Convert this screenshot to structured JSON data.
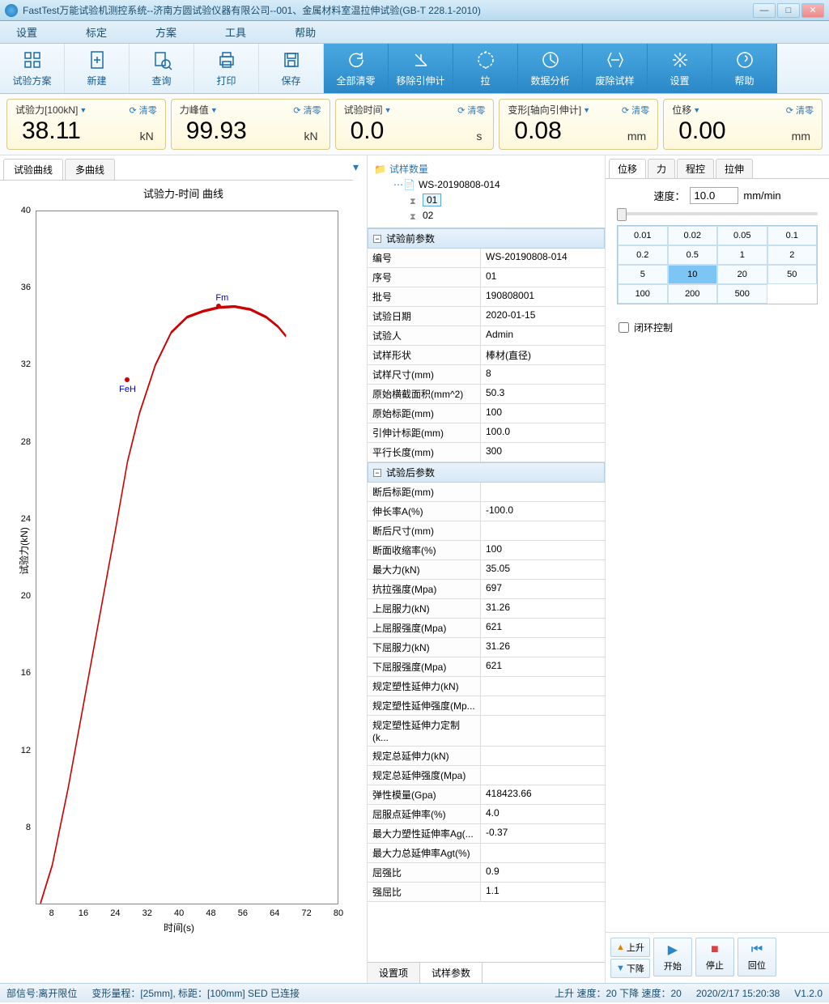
{
  "titlebar": {
    "title": "FastTest万能试验机测控系统--济南方圆试验仪器有限公司--001、金属材料室温拉伸试验(GB-T 228.1-2010)"
  },
  "menu": [
    "设置",
    "标定",
    "方案",
    "工具",
    "帮助"
  ],
  "toolbar": [
    {
      "label": "试验方案",
      "accent": false
    },
    {
      "label": "新建",
      "accent": false
    },
    {
      "label": "查询",
      "accent": false
    },
    {
      "label": "打印",
      "accent": false
    },
    {
      "label": "保存",
      "accent": false
    },
    {
      "label": "全部清零",
      "accent": true
    },
    {
      "label": "移除引伸计",
      "accent": true
    },
    {
      "label": "拉",
      "accent": true
    },
    {
      "label": "数据分析",
      "accent": true
    },
    {
      "label": "废除试样",
      "accent": true
    },
    {
      "label": "设置",
      "accent": true
    },
    {
      "label": "帮助",
      "accent": true
    }
  ],
  "meters": [
    {
      "label": "试验力[100kN]",
      "value": "38.11",
      "unit": "kN",
      "reset": "清零"
    },
    {
      "label": "力峰值",
      "value": "99.93",
      "unit": "kN",
      "reset": "清零"
    },
    {
      "label": "试验时间",
      "value": "0.0",
      "unit": "s",
      "reset": "清零"
    },
    {
      "label": "变形[轴向引伸计]",
      "value": "0.08",
      "unit": "mm",
      "reset": "清零"
    },
    {
      "label": "位移",
      "value": "0.00",
      "unit": "mm",
      "reset": "清零"
    }
  ],
  "left_tabs": [
    "试验曲线",
    "多曲线"
  ],
  "chart": {
    "title": "试验力-时间 曲线",
    "xlabel": "时间(s)",
    "ylabel": "试验力(kN)",
    "yticks": [
      "8",
      "12",
      "16",
      "20",
      "24",
      "28",
      "32",
      "36",
      "40"
    ],
    "xticks": [
      "8",
      "16",
      "24",
      "32",
      "40",
      "48",
      "56",
      "64",
      "72",
      "80"
    ],
    "markers": {
      "feh": "FeH",
      "fm": "Fm"
    }
  },
  "tree": {
    "title": "试样数量",
    "batch": "WS-20190808-014",
    "items": [
      "01",
      "02"
    ]
  },
  "params": {
    "section1": "试验前参数",
    "s1": [
      [
        "编号",
        "WS-20190808-014"
      ],
      [
        "序号",
        "01"
      ],
      [
        "批号",
        "190808001"
      ],
      [
        "试验日期",
        "2020-01-15"
      ],
      [
        "试验人",
        "Admin"
      ],
      [
        "试样形状",
        "棒材(直径)"
      ],
      [
        "试样尺寸(mm)",
        "8"
      ],
      [
        "原始横截面积(mm^2)",
        "50.3"
      ],
      [
        "原始标距(mm)",
        "100"
      ],
      [
        "引伸计标距(mm)",
        "100.0"
      ],
      [
        "平行长度(mm)",
        "300"
      ]
    ],
    "section2": "试验后参数",
    "s2": [
      [
        "断后标距(mm)",
        ""
      ],
      [
        "伸长率A(%)",
        "-100.0"
      ],
      [
        "断后尺寸(mm)",
        ""
      ],
      [
        "断面收缩率(%)",
        "100"
      ],
      [
        "最大力(kN)",
        "35.05"
      ],
      [
        "抗拉强度(Mpa)",
        "697"
      ],
      [
        "上屈服力(kN)",
        "31.26"
      ],
      [
        "上屈服强度(Mpa)",
        "621"
      ],
      [
        "下屈服力(kN)",
        "31.26"
      ],
      [
        "下屈服强度(Mpa)",
        "621"
      ],
      [
        "规定塑性延伸力(kN)",
        ""
      ],
      [
        "规定塑性延伸强度(Mp...",
        ""
      ],
      [
        "规定塑性延伸力定制(k...",
        ""
      ],
      [
        "规定总延伸力(kN)",
        ""
      ],
      [
        "规定总延伸强度(Mpa)",
        ""
      ],
      [
        "弹性模量(Gpa)",
        "418423.66"
      ],
      [
        "屈服点延伸率(%)",
        "4.0"
      ],
      [
        "最大力塑性延伸率Ag(...",
        "-0.37"
      ],
      [
        "最大力总延伸率Agt(%)",
        ""
      ],
      [
        "屈强比",
        "0.9"
      ],
      [
        "强屈比",
        "1.1"
      ]
    ]
  },
  "bottom_tabs": [
    "设置项",
    "试样参数"
  ],
  "right_tabs": [
    "位移",
    "力",
    "程控",
    "拉伸"
  ],
  "speed": {
    "label": "速度：",
    "value": "10.0",
    "unit": "mm/min"
  },
  "speed_presets": [
    "0.01",
    "0.02",
    "0.05",
    "0.1",
    "0.2",
    "0.5",
    "1",
    "2",
    "5",
    "10",
    "20",
    "50",
    "100",
    "200",
    "500",
    ""
  ],
  "closed_loop": "闭环控制",
  "ctrls": {
    "up": "上升",
    "down": "下降",
    "start": "开始",
    "stop": "停止",
    "return": "回位"
  },
  "status": {
    "left": "部信号:离开限位",
    "mid": "变形量程：[25mm], 标距：[100mm]  SED 已连接",
    "right1": "上升 速度：20 下降 速度：20",
    "time": "2020/2/17 15:20:38",
    "ver": "V1.2.0"
  },
  "chart_data": {
    "type": "line",
    "title": "试验力-时间 曲线",
    "xlabel": "时间(s)",
    "ylabel": "试验力(kN)",
    "xlim": [
      4,
      80
    ],
    "ylim": [
      4,
      40
    ],
    "series": [
      {
        "name": "试验力",
        "x": [
          5,
          8,
          12,
          16,
          20,
          24,
          27,
          30,
          34,
          38,
          42,
          46,
          50,
          54,
          58,
          62,
          65,
          67
        ],
        "y": [
          4,
          6,
          10,
          14.5,
          19,
          23.5,
          27,
          29.5,
          32,
          33.7,
          34.5,
          34.8,
          35,
          35.05,
          34.9,
          34.5,
          34,
          33.5
        ]
      }
    ],
    "annotations": [
      {
        "label": "FeH",
        "x": 27,
        "y": 31.2
      },
      {
        "label": "Fm",
        "x": 50,
        "y": 35.05
      }
    ]
  }
}
